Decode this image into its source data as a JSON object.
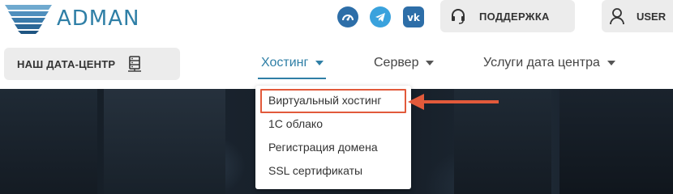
{
  "header": {
    "logo_text": "ADMAN",
    "social": [
      {
        "icon": "speedometer-icon",
        "color": "#2d6ea8"
      },
      {
        "icon": "telegram-icon",
        "color": "#3aa2dd"
      },
      {
        "icon": "vk-icon",
        "color": "#2d6ea8"
      }
    ],
    "support_label": "ПОДДЕРЖКА",
    "user_label": "USER"
  },
  "nav": {
    "datacenter_label": "НАШ ДАТА-ЦЕНТР",
    "items": [
      {
        "label": "Хостинг",
        "active": true
      },
      {
        "label": "Сервер",
        "active": false
      },
      {
        "label": "Услуги дата центра",
        "active": false
      }
    ]
  },
  "dropdown": {
    "items": [
      {
        "label": "Виртуальный хостинг",
        "highlighted": true
      },
      {
        "label": "1С облако"
      },
      {
        "label": "Регистрация домена"
      },
      {
        "label": "SSL сертификаты"
      }
    ]
  },
  "colors": {
    "accent": "#2f7fa6",
    "annotation": "#e25a3b",
    "button_bg": "#ececec"
  }
}
